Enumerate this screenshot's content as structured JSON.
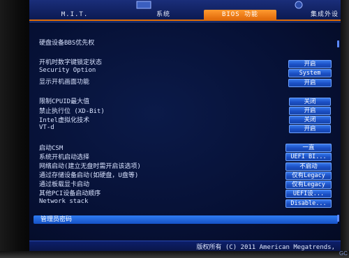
{
  "tabs": {
    "mit": "M.I.T.",
    "system": "系统",
    "bios": "BIOS 功能",
    "peripherals": "集成外设"
  },
  "rows": {
    "bbs_priority": "硬盘设备BBS优先权",
    "boot_numlock": "开机时数字键锁定状态",
    "security_option": "Security Option",
    "show_boot_logo": "显示开机画面功能",
    "limit_cpuid": "限制CPUID最大值",
    "xd_bit": "禁止执行位 (XD-Bit)",
    "intel_virt": "Intel虚拟化技术",
    "vtd": "VT-d",
    "csm": "启动CSM",
    "system_boot": "系统开机启动选择",
    "network_boot": "网络启动(建立无盘时需开启该选项)",
    "storage_boot": "通过存储设备启动(如硬盘，U盘等)",
    "gpu_boot": "通过板载显卡启动",
    "other_pci": "其他PCI设备启动顺序",
    "network_stack": "Network stack"
  },
  "values": {
    "boot_numlock": "开启",
    "security_option": "System",
    "show_boot_logo": "开启",
    "limit_cpuid": "关闭",
    "xd_bit": "开启",
    "intel_virt": "关闭",
    "vtd": "开启",
    "csm": "一直",
    "system_boot": "UEFI BI...",
    "network_boot": "不启动",
    "storage_boot": "仅有Legacy",
    "gpu_boot": "仅有Legacy",
    "other_pci": "UEFI设...",
    "network_stack": "Disable..."
  },
  "admin_password": "管理员密码",
  "footer": "版权所有 (C) 2011 American Megatrends,",
  "watermark": "GC"
}
